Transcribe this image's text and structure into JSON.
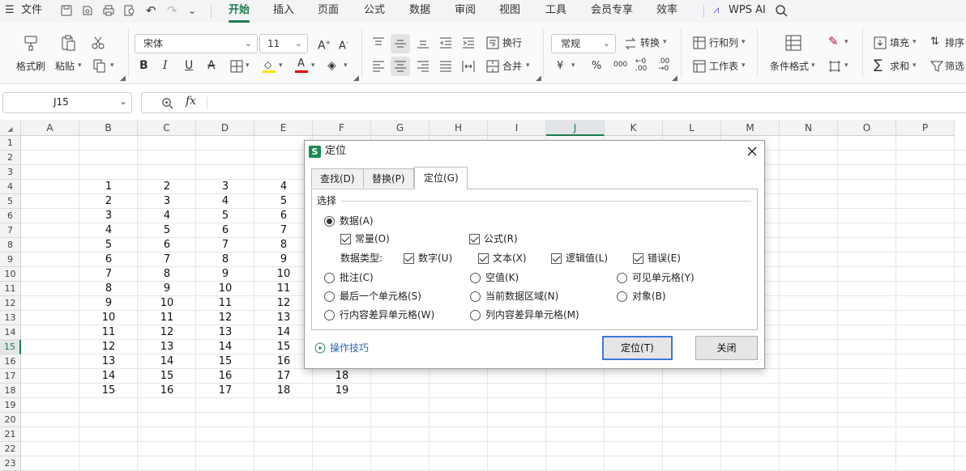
{
  "menu": {
    "file": "文件",
    "tabs": [
      "开始",
      "插入",
      "页面",
      "公式",
      "数据",
      "审阅",
      "视图",
      "工具",
      "会员专享",
      "效率"
    ],
    "wps_ai": "WPS AI"
  },
  "ribbon": {
    "format_painter": "格式刷",
    "paste": "粘贴",
    "font_name": "宋体",
    "font_size": "11",
    "wrap": "换行",
    "merge": "合并",
    "number_format": "常规",
    "convert": "转换",
    "row_col": "行和列",
    "worksheet": "工作表",
    "cond_format": "条件格式",
    "fill": "填充",
    "sort": "排序",
    "sum": "求和",
    "filter": "筛选",
    "currency": "¥",
    "percent": "%"
  },
  "formula_bar": {
    "cell_ref": "J15",
    "fx": "fx",
    "value": ""
  },
  "grid": {
    "columns": [
      "A",
      "B",
      "C",
      "D",
      "E",
      "F",
      "G",
      "H",
      "I",
      "J",
      "K",
      "L",
      "M",
      "N",
      "O",
      "P"
    ],
    "rows": [
      "1",
      "2",
      "3",
      "4",
      "5",
      "6",
      "7",
      "8",
      "9",
      "10",
      "11",
      "12",
      "13",
      "14",
      "15",
      "16",
      "17",
      "18",
      "19",
      "20",
      "21",
      "22",
      "23"
    ],
    "selected_column": "J",
    "selected_row": "15",
    "data": [
      [
        "1",
        "2",
        "3",
        "4",
        ""
      ],
      [
        "2",
        "3",
        "4",
        "5",
        ""
      ],
      [
        "3",
        "4",
        "5",
        "6",
        ""
      ],
      [
        "4",
        "5",
        "6",
        "7",
        ""
      ],
      [
        "5",
        "6",
        "7",
        "8",
        ""
      ],
      [
        "6",
        "7",
        "8",
        "9",
        ""
      ],
      [
        "7",
        "8",
        "9",
        "10",
        ""
      ],
      [
        "8",
        "9",
        "10",
        "11",
        ""
      ],
      [
        "9",
        "10",
        "11",
        "12",
        ""
      ],
      [
        "10",
        "11",
        "12",
        "13",
        ""
      ],
      [
        "11",
        "12",
        "13",
        "14",
        ""
      ],
      [
        "12",
        "13",
        "14",
        "15",
        ""
      ],
      [
        "13",
        "14",
        "15",
        "16",
        ""
      ],
      [
        "14",
        "15",
        "16",
        "17",
        "18"
      ],
      [
        "15",
        "16",
        "17",
        "18",
        "19"
      ]
    ]
  },
  "dialog": {
    "title": "定位",
    "tabs": [
      "查找(D)",
      "替换(P)",
      "定位(G)"
    ],
    "group_label": "选择",
    "data_option": "数据(A)",
    "constants": "常量(O)",
    "formulas": "公式(R)",
    "data_type_label": "数据类型:",
    "numbers": "数字(U)",
    "text": "文本(X)",
    "logicals": "逻辑值(L)",
    "errors": "错误(E)",
    "comments": "批注(C)",
    "blanks": "空值(K)",
    "visible_cells": "可见单元格(Y)",
    "last_cell": "最后一个单元格(S)",
    "current_region": "当前数据区域(N)",
    "objects": "对象(B)",
    "row_diff": "行内容差异单元格(W)",
    "col_diff": "列内容差异单元格(M)",
    "tips": "操作技巧",
    "ok_button": "定位(T)",
    "close_button": "关闭"
  }
}
